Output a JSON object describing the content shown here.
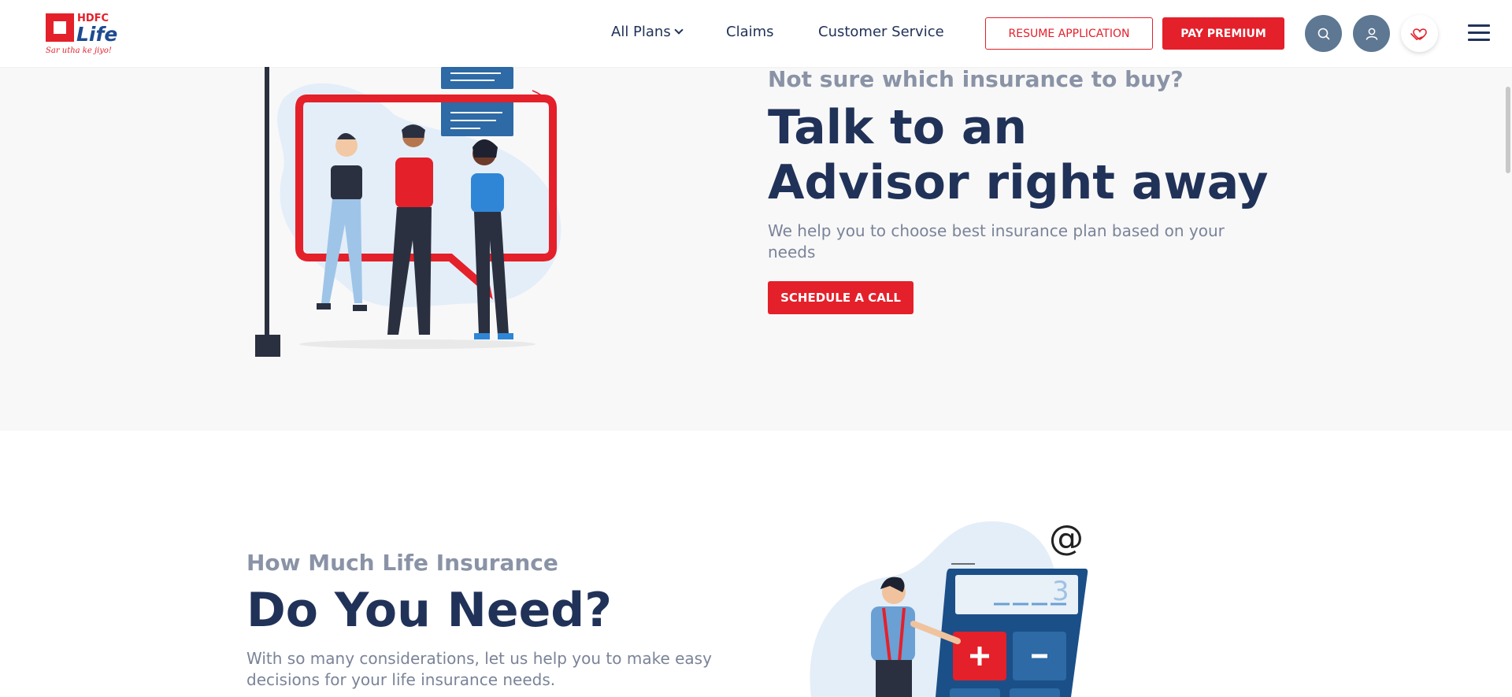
{
  "header": {
    "logo": {
      "brand_top": "HDFC",
      "brand_main": "Life",
      "tagline": "Sar utha ke jiyo!"
    },
    "nav": {
      "all_plans": "All Plans",
      "claims": "Claims",
      "customer_service": "Customer Service"
    },
    "resume_label": "RESUME APPLICATION",
    "pay_label": "PAY PREMIUM",
    "icons": [
      "search-icon",
      "user-icon",
      "heart-hand-icon",
      "menu-icon"
    ]
  },
  "advisor": {
    "subtitle": "Not sure which insurance to buy?",
    "title_line1": "Talk to an",
    "title_line2": "Advisor right away",
    "description": "We help you to choose best insurance plan based on your needs",
    "cta": "SCHEDULE A CALL"
  },
  "calculator": {
    "subtitle": "How Much Life Insurance",
    "title": "Do You Need?",
    "description": "With so many considerations, let us help you to make easy decisions for your life insurance needs.",
    "display_digit": "3",
    "at_symbol": "@"
  },
  "colors": {
    "brand_red": "#e4202a",
    "navy": "#213259",
    "muted": "#8a93a6",
    "icon_bg": "#5e7792"
  }
}
